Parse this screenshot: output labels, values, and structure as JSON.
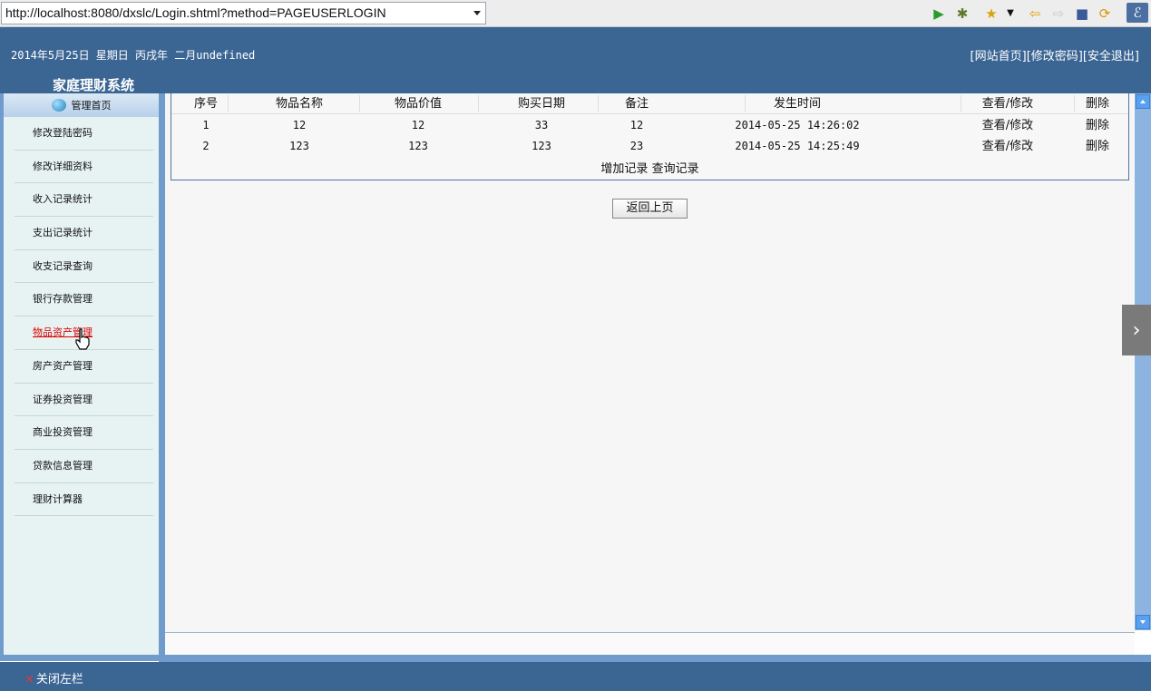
{
  "browser": {
    "url": "http://localhost:8080/dxslc/Login.shtml?method=PAGEUSERLOGIN",
    "icons": [
      "play-icon",
      "debug-icon",
      "favorite-icon",
      "dropdown-icon",
      "back-icon",
      "forward-icon",
      "stop-icon",
      "refresh-icon",
      "eclipse-icon"
    ]
  },
  "header": {
    "date": "2014年5月25日 星期日 丙戌年 二月undefined",
    "links": [
      "[网站首页]",
      "[修改密码]",
      "[安全退出]"
    ],
    "system_title": "家庭理财系统"
  },
  "sidebar": {
    "home": "管理首页",
    "items": [
      "修改登陆密码",
      "修改详细资料",
      "收入记录统计",
      "支出记录统计",
      "收支记录查询",
      "银行存款管理",
      "物品资产管理",
      "房产资产管理",
      "证券投资管理",
      "商业投资管理",
      "贷款信息管理",
      "理财计算器"
    ],
    "active_index": 6
  },
  "table": {
    "columns": [
      "序号",
      "物品名称",
      "物品价值",
      "购买日期",
      "备注",
      "发生时间",
      "查看/修改",
      "删除"
    ],
    "rows": [
      [
        "1",
        "12",
        "12",
        "33",
        "12",
        "2014-05-25 14:26:02",
        "查看/修改",
        "删除"
      ],
      [
        "2",
        "123",
        "123",
        "123",
        "23",
        "2014-05-25 14:25:49",
        "查看/修改",
        "删除"
      ]
    ],
    "add_link": "增加记录",
    "query_link": "查询记录"
  },
  "back_button": "返回上页",
  "footer": {
    "close_sidebar": "关闭左栏"
  },
  "colors": {
    "header_blue": "#3b6593",
    "sidebar_border": "#6f9ccc",
    "sidebar_bg": "#e7f3f3",
    "active_link": "#dd0000"
  }
}
